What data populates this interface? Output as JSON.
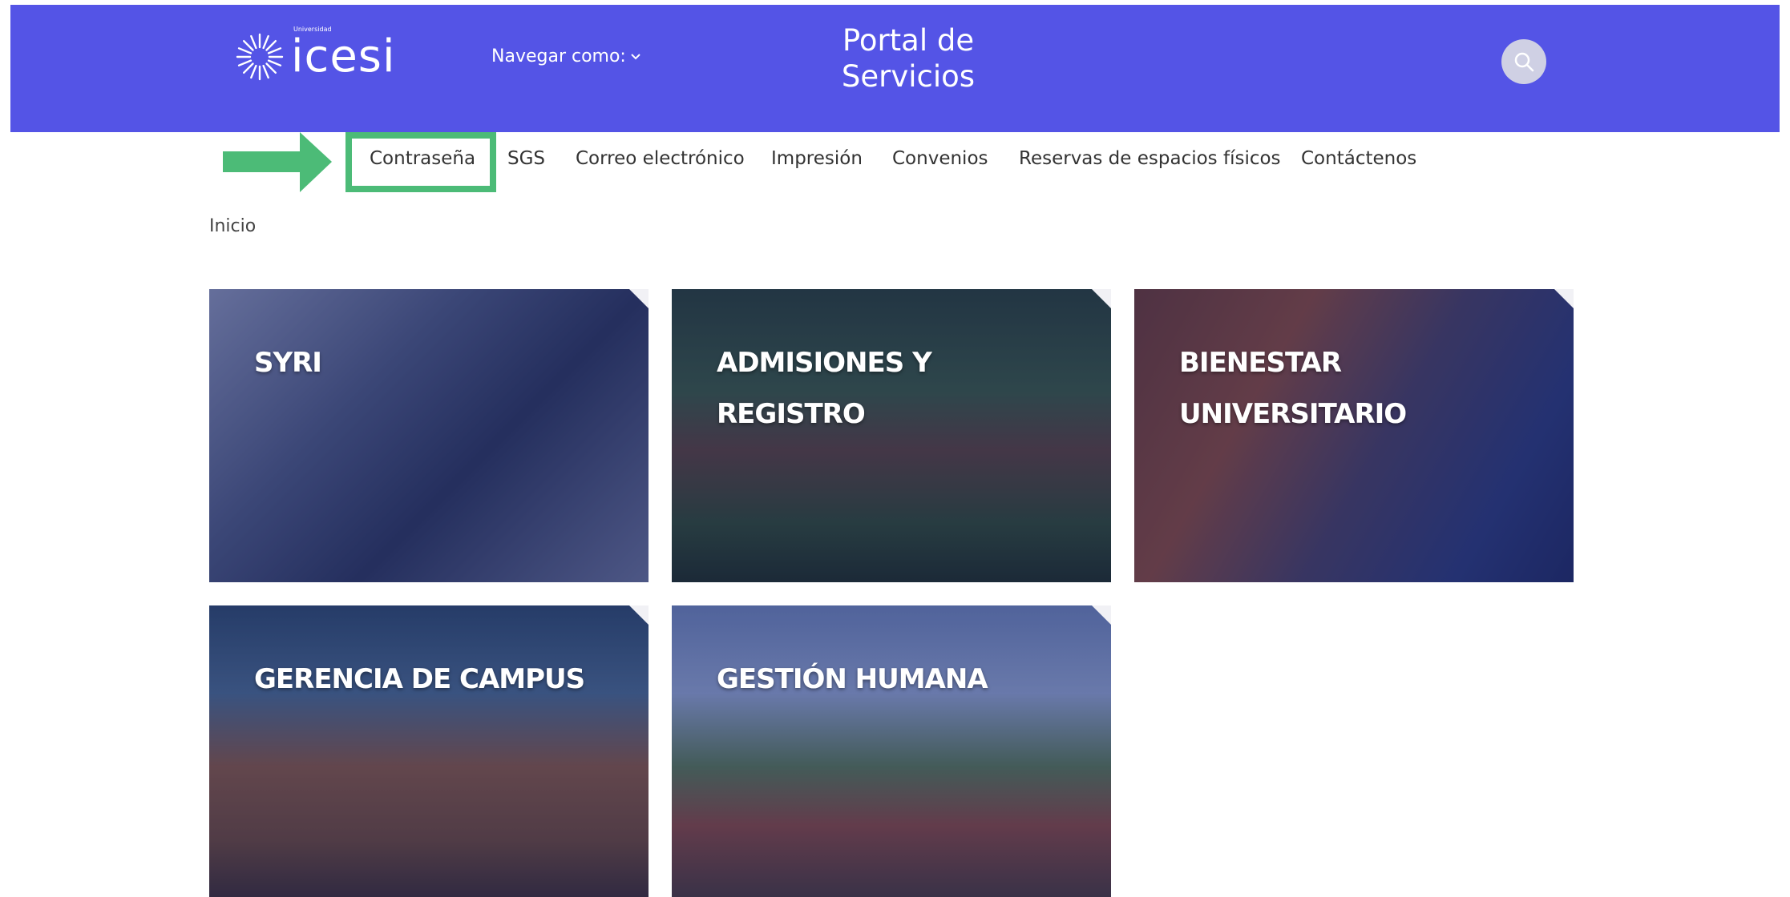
{
  "header": {
    "logo_text": "icesi",
    "logo_small_text": "Universidad",
    "navigate_as_label": "Navegar como:",
    "portal_title": "Portal de Servicios"
  },
  "nav": {
    "items": [
      {
        "label": "Contraseña",
        "highlighted": true
      },
      {
        "label": "SGS"
      },
      {
        "label": "Correo electrónico"
      },
      {
        "label": "Impresión"
      },
      {
        "label": "Convenios"
      },
      {
        "label": "Reservas de espacios físicos"
      },
      {
        "label": "Contáctenos"
      }
    ]
  },
  "breadcrumb": "Inicio",
  "cards": [
    {
      "title": "SYRI"
    },
    {
      "title": "ADMISIONES Y REGISTRO"
    },
    {
      "title": "BIENESTAR UNIVERSITARIO"
    },
    {
      "title": "GERENCIA DE CAMPUS"
    },
    {
      "title": "GESTIÓN HUMANA"
    }
  ],
  "colors": {
    "header_bg": "#5454e6",
    "highlight": "#4cbb77",
    "card_overlay": "#19236e"
  },
  "icons": {
    "search": "search-icon",
    "chevron": "chevron-down-icon",
    "arrow": "arrow-right-icon"
  }
}
